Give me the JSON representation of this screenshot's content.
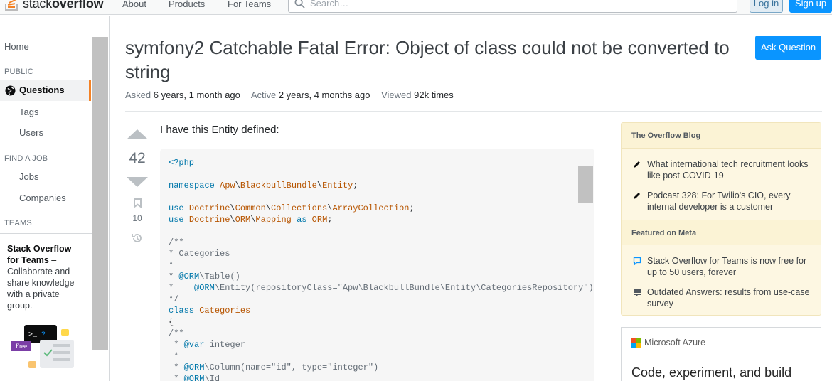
{
  "header": {
    "logo_text_pre": "stack",
    "logo_text_bold": "overflow",
    "nav": [
      "About",
      "Products",
      "For Teams"
    ],
    "search_placeholder": "Search…",
    "login": "Log in",
    "signup": "Sign up"
  },
  "sidebar": {
    "home": "Home",
    "public_heading": "PUBLIC",
    "questions": "Questions",
    "tags": "Tags",
    "users": "Users",
    "job_heading": "FIND A JOB",
    "jobs": "Jobs",
    "companies": "Companies",
    "teams_heading": "TEAMS",
    "teams_title": "Stack Overflow for Teams",
    "teams_dash": " –",
    "teams_desc": "Collaborate and share knowledge with a private group.",
    "free_badge": "Free"
  },
  "question": {
    "title": "symfony2 Catchable Fatal Error: Object of class could not be converted to string",
    "ask_button": "Ask Question",
    "asked_label": "Asked",
    "asked_value": "6 years, 1 month ago",
    "active_label": "Active",
    "active_value": "2 years, 4 months ago",
    "viewed_label": "Viewed",
    "viewed_value": "92k times",
    "votes": "42",
    "bookmarks": "10",
    "intro": "I have this Entity defined:"
  },
  "code_lines": [
    "<?php",
    "",
    "namespace Apw\\BlackbullBundle\\Entity;",
    "",
    "use Doctrine\\Common\\Collections\\ArrayCollection;",
    "use Doctrine\\ORM\\Mapping as ORM;",
    "",
    "/**",
    "* Categories",
    "*",
    "* @ORM\\Table()",
    "*    @ORM\\Entity(repositoryClass=\"Apw\\BlackbullBundle\\Entity\\CategoriesRepository\")",
    "*/",
    "class Categories",
    "{",
    "/**",
    " * @var integer",
    " *",
    " * @ORM\\Column(name=\"id\", type=\"integer\")",
    " * @ORM\\Id"
  ],
  "right": {
    "blog_heading": "The Overflow Blog",
    "blog_items": [
      "What international tech recruitment looks like post-COVID-19",
      "Podcast 328: For Twilio's CIO, every internal developer is a customer"
    ],
    "meta_heading": "Featured on Meta",
    "meta_items": [
      "Stack Overflow for Teams is now free for up to 50 users, forever",
      "Outdated Answers: results from use-case survey"
    ],
    "ad_brand": "Microsoft Azure",
    "ad_headline": "Code, experiment, and build"
  },
  "colors": {
    "accent_orange": "#f48225",
    "primary_blue": "#0a95ff",
    "blog_bg": "#fdf7e2"
  }
}
